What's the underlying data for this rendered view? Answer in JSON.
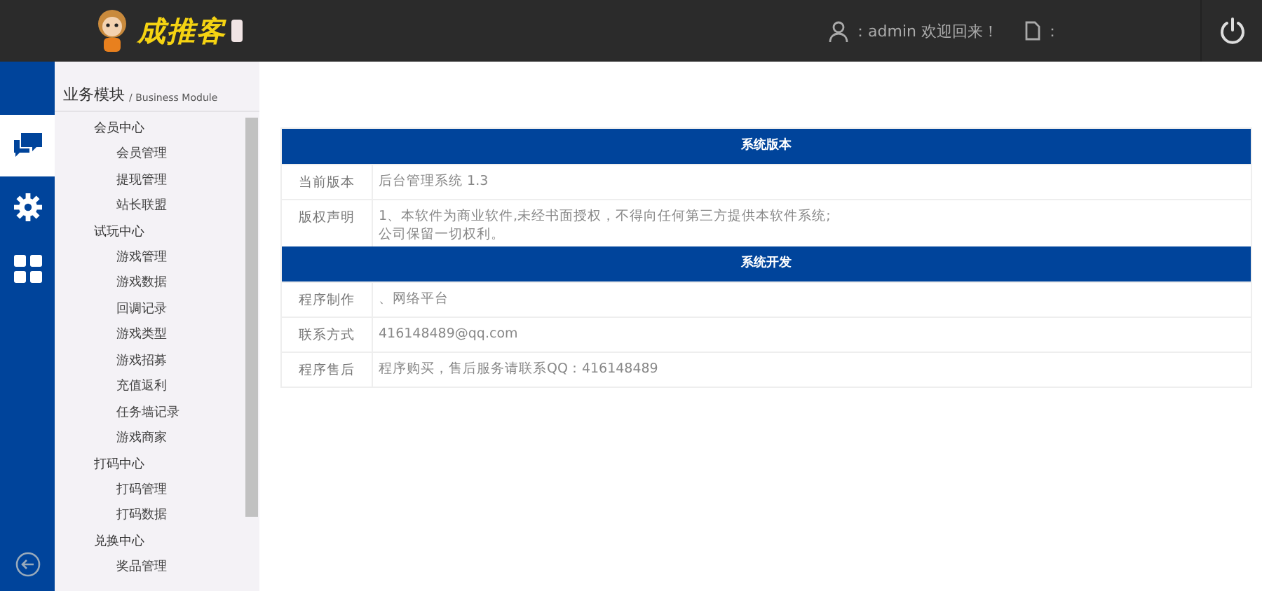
{
  "header": {
    "logo_text": "成推客",
    "user_label": "：admin 欢迎回来！",
    "doc_label": "："
  },
  "icon_bar": [
    {
      "kind": "chat",
      "selected": true
    },
    {
      "kind": "gear",
      "selected": false
    },
    {
      "kind": "grid",
      "selected": false
    }
  ],
  "sidebar": {
    "title": "业务模块",
    "subtitle": "/ Business Module",
    "groups": [
      {
        "label": "会员中心",
        "children": [
          {
            "label": "会员管理"
          },
          {
            "label": "提现管理"
          },
          {
            "label": "站长联盟"
          }
        ]
      },
      {
        "label": "试玩中心",
        "children": [
          {
            "label": "游戏管理"
          },
          {
            "label": "游戏数据"
          },
          {
            "label": "回调记录"
          },
          {
            "label": "游戏类型"
          },
          {
            "label": "游戏招募"
          },
          {
            "label": "充值返利"
          },
          {
            "label": "任务墙记录"
          },
          {
            "label": "游戏商家"
          }
        ]
      },
      {
        "label": "打码中心",
        "children": [
          {
            "label": "打码管理"
          },
          {
            "label": "打码数据"
          }
        ]
      },
      {
        "label": "兑换中心",
        "children": [
          {
            "label": "奖品管理"
          }
        ]
      }
    ]
  },
  "sections": [
    {
      "title": "系统版本",
      "rows": [
        {
          "label": "当前版本",
          "lines": [
            "后台管理系统 1.3"
          ]
        },
        {
          "label": "版权声明",
          "lines": [
            "1、本软件为商业软件,未经书面授权，不得向任何第三方提供本软件系统;",
            "公司保留一切权利。"
          ]
        }
      ]
    },
    {
      "title": "系统开发",
      "rows": [
        {
          "label": "程序制作",
          "lines": [
            "、网络平台"
          ]
        },
        {
          "label": "联系方式",
          "lines": [
            "416148489@qq.com"
          ]
        },
        {
          "label": "程序售后",
          "lines": [
            "程序购买，售后服务请联系QQ：416148489"
          ]
        }
      ]
    }
  ]
}
